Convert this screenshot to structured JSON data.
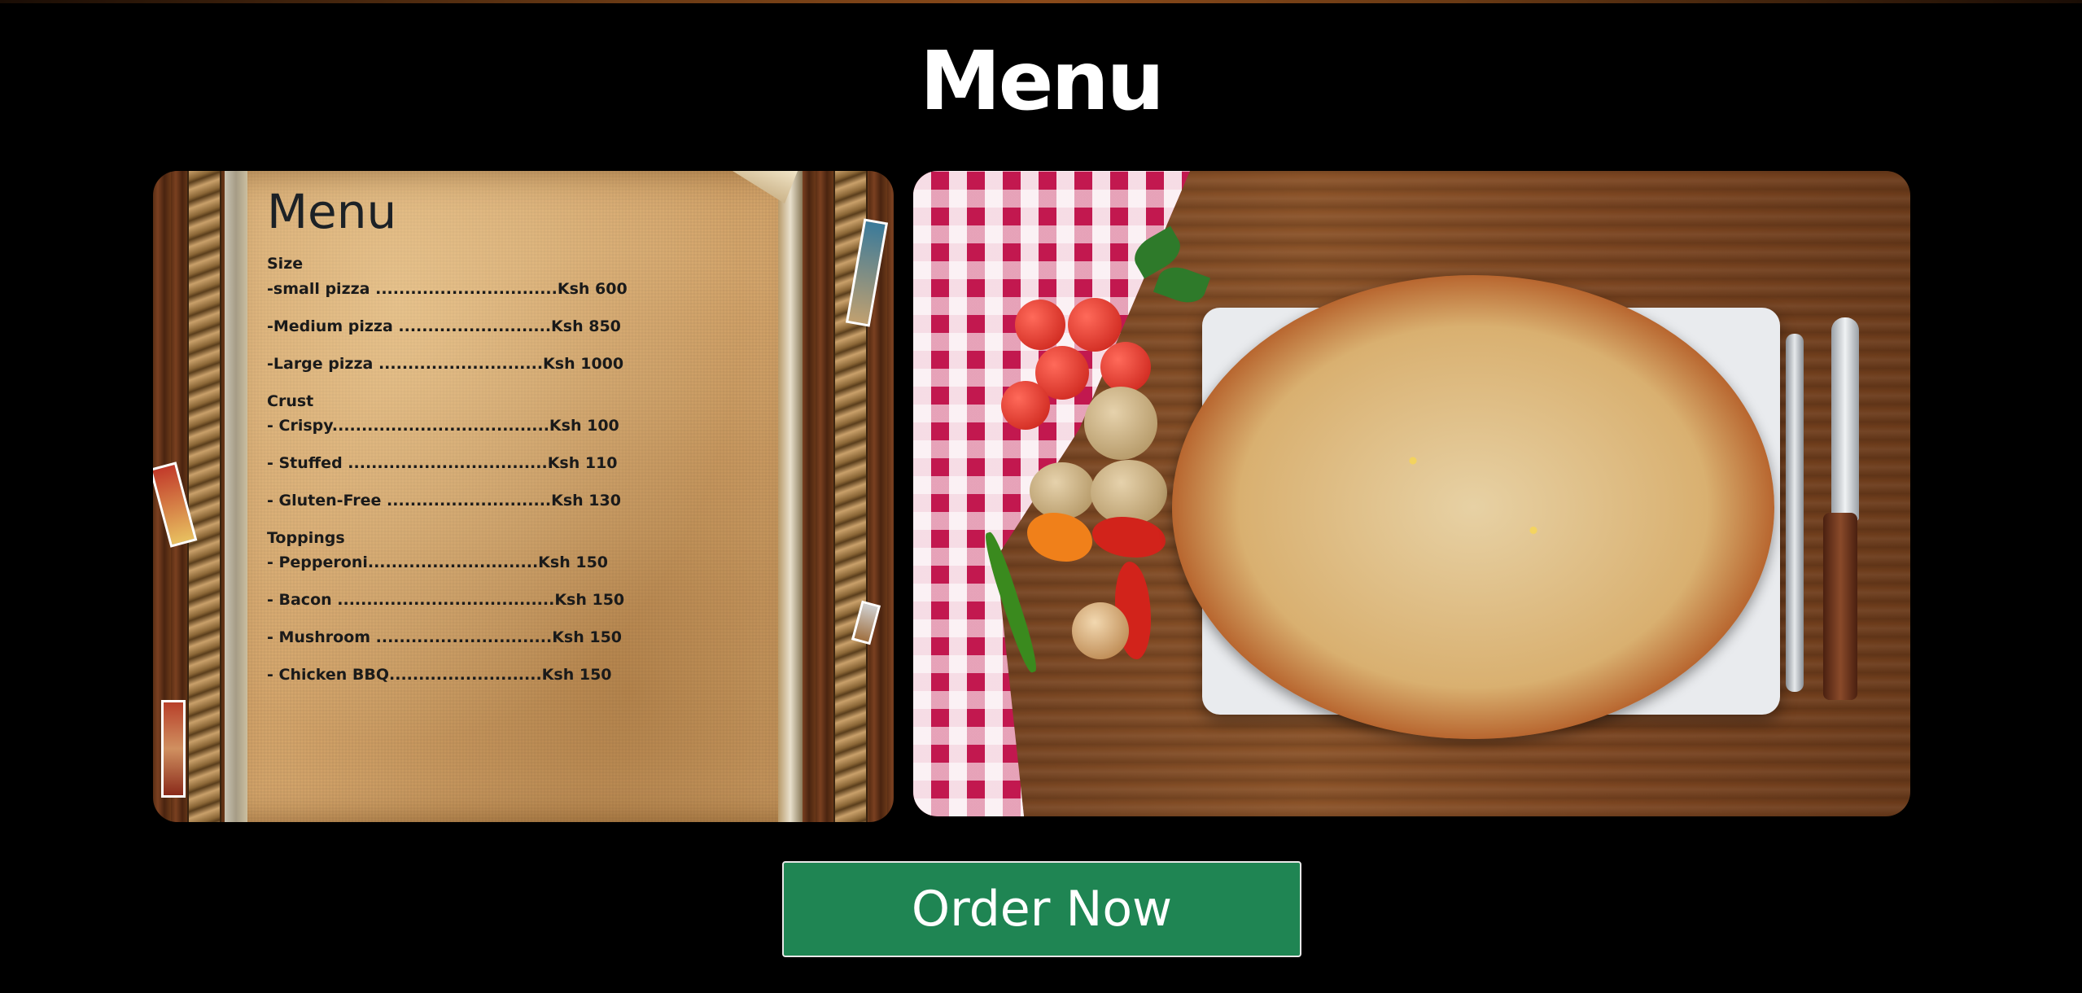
{
  "page": {
    "title": "Menu"
  },
  "menu_card": {
    "heading": "Menu",
    "sections": [
      {
        "title": "Size",
        "items": [
          "-small pizza ...............................Ksh 600",
          "-Medium pizza ..........................Ksh 850",
          "-Large pizza ............................Ksh 1000"
        ]
      },
      {
        "title": "Crust",
        "items": [
          "- Crispy.....................................Ksh 100",
          "- Stuffed ..................................Ksh 110",
          "- Gluten-Free ............................Ksh 130"
        ]
      },
      {
        "title": "Toppings",
        "items": [
          "- Pepperoni.............................Ksh 150",
          "- Bacon .....................................Ksh 150",
          "- Mushroom ..............................Ksh 150",
          "- Chicken BBQ..........................Ksh 150"
        ]
      }
    ]
  },
  "order_button": {
    "label": "Order Now"
  },
  "colors": {
    "background": "#000000",
    "button": "#1f8553",
    "title_text": "#ffffff",
    "menu_text": "#1a1a1a"
  }
}
